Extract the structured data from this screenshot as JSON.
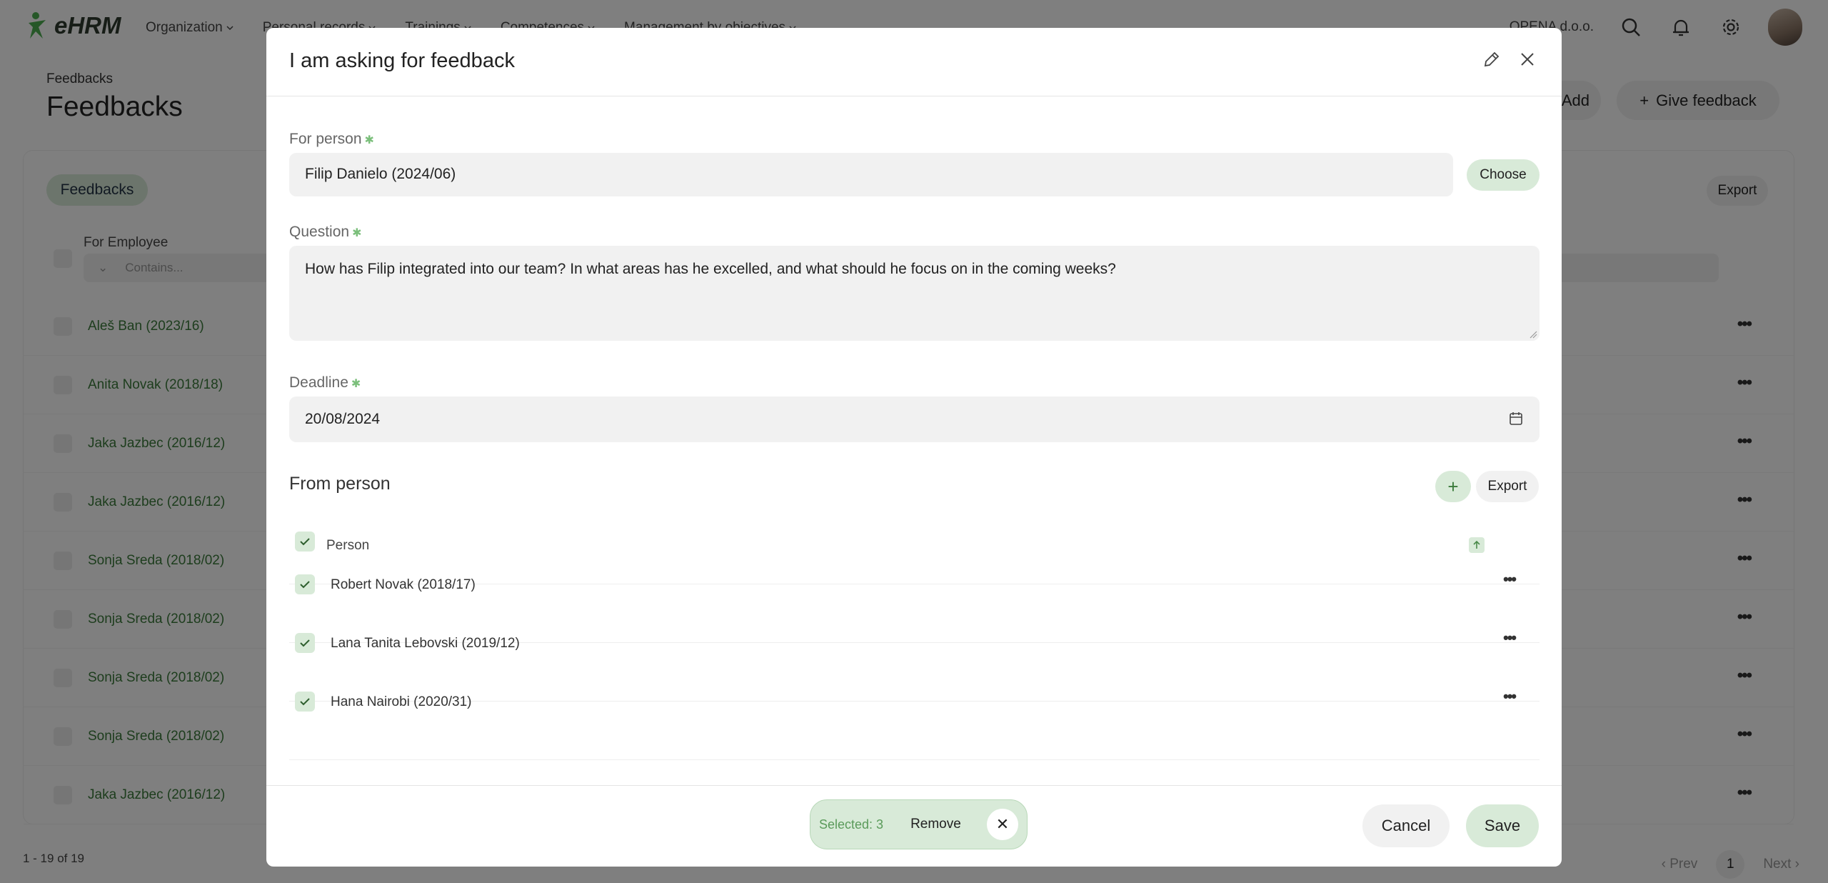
{
  "app": {
    "logo_text": "eHRM",
    "nav": [
      "Organization",
      "Personal records",
      "Trainings",
      "Competences",
      "Management by objectives"
    ],
    "company": "OPENA d.o.o."
  },
  "page": {
    "breadcrumb": "Feedbacks",
    "title": "Feedbacks",
    "add_label": "Add",
    "give_feedback_label": "Give feedback",
    "tab_label": "Feedbacks",
    "export_label": "Export",
    "column_for_employee": "For Employee",
    "filter_placeholder": "Contains...",
    "rows": [
      "Aleš Ban (2023/16)",
      "Anita Novak (2018/18)",
      "Jaka Jazbec (2016/12)",
      "Jaka Jazbec (2016/12)",
      "Sonja Sreda (2018/02)",
      "Sonja Sreda (2018/02)",
      "Sonja Sreda (2018/02)",
      "Sonja Sreda (2018/02)",
      "Jaka Jazbec (2016/12)"
    ],
    "pager_info": "1 - 19 of 19",
    "prev_label": "Prev",
    "current_page": "1",
    "next_label": "Next"
  },
  "modal": {
    "title": "I am asking for feedback",
    "for_person_label": "For person",
    "for_person_value": "Filip Danielo (2024/06)",
    "choose_label": "Choose",
    "question_label": "Question",
    "question_value": "How has Filip integrated into our team? In what areas has he excelled, and what should he focus on in the coming weeks?",
    "deadline_label": "Deadline",
    "deadline_value": "20/08/2024",
    "from_person_title": "From person",
    "export_label": "Export",
    "table_header": "Person",
    "persons": [
      "Robert Novak (2018/17)",
      "Lana Tanita Lebovski (2019/12)",
      "Hana Nairobi (2020/31)"
    ],
    "selected_text": "Selected: 3",
    "remove_label": "Remove",
    "cancel_label": "Cancel",
    "save_label": "Save"
  },
  "colors": {
    "accent_green": "#d8ead8",
    "link_green": "#3b7a3b"
  }
}
